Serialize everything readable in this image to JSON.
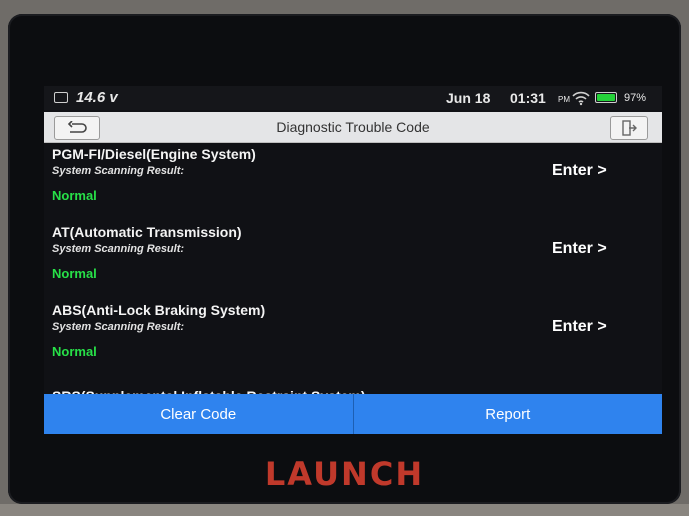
{
  "status_bar": {
    "voltage": "14.6 v",
    "date": "Jun 18",
    "time": "01:31",
    "ampm": "PM",
    "battery_pct": "97%",
    "battery_color": "#25d33a"
  },
  "title_bar": {
    "title": "Diagnostic Trouble Code",
    "back_icon": "back-arrow-icon",
    "exit_icon": "exit-icon"
  },
  "systems": [
    {
      "name": "PGM-FI/Diesel(Engine System)",
      "scan_label": "System Scanning Result:",
      "status": "Normal",
      "enter": "Enter >"
    },
    {
      "name": "AT(Automatic Transmission)",
      "scan_label": "System Scanning Result:",
      "status": "Normal",
      "enter": "Enter >"
    },
    {
      "name": "ABS(Anti-Lock Braking System)",
      "scan_label": "System Scanning Result:",
      "status": "Normal",
      "enter": "Enter >"
    }
  ],
  "partial_item": "SRS(Supplemental Inflatable Restraint System)",
  "bottom_bar": {
    "clear_code": "Clear Code",
    "report": "Report",
    "accent_color": "#2f83ee"
  },
  "brand": "LAUNCH"
}
